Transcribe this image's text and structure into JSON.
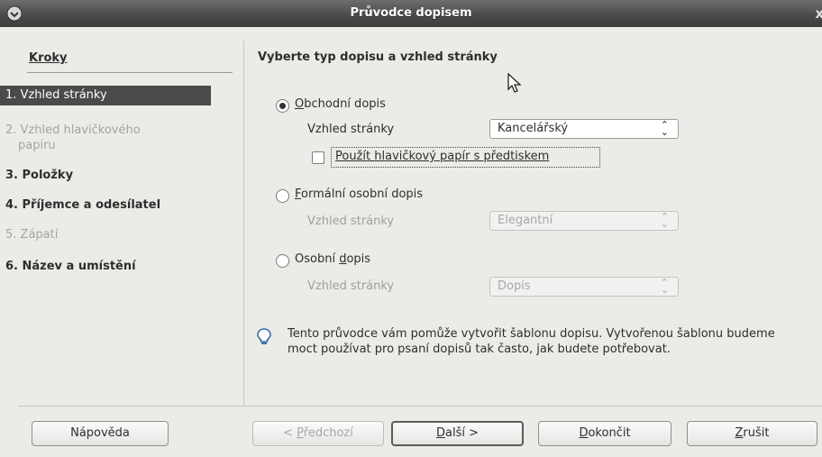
{
  "window": {
    "title": "Průvodce dopisem",
    "close_glyph": "x"
  },
  "steps": {
    "header": "Kroky",
    "items": [
      {
        "label": "1. Vzhled stránky",
        "state": "active"
      },
      {
        "label": "2. Vzhled hlavičkového",
        "label2": "papíru",
        "state": "disabled"
      },
      {
        "label": "3. Položky",
        "state": "normal"
      },
      {
        "label": "4. Příjemce a odesílatel",
        "state": "normal"
      },
      {
        "label": "5. Zápatí",
        "state": "disabled"
      },
      {
        "label": "6. Název a umístění",
        "state": "normal"
      }
    ]
  },
  "main": {
    "title": "Vyberte typ dopisu a vzhled stránky",
    "options": [
      {
        "first": "O",
        "rest": "bchodní dopis",
        "checked": true,
        "style_label": "Vzhled stránky",
        "style_value": "Kancelářský",
        "enabled": true
      },
      {
        "first": "F",
        "rest": "ormální osobní dopis",
        "checked": false,
        "style_label": "Vzhled stránky",
        "style_value": "Elegantní",
        "enabled": false
      },
      {
        "pre": "Osobní ",
        "first": "d",
        "rest": "opis",
        "checked": false,
        "style_label": "Vzhled stránky",
        "style_value": "Dopis",
        "enabled": false
      }
    ],
    "letterhead_checkbox": {
      "first": "P",
      "rest": "oužít hlavičkový papír s předtiskem",
      "checked": false
    },
    "info_text": "Tento průvodce vám pomůže vytvořit šablonu dopisu. Vytvořenou šablonu budeme moct používat pro psaní dopisů tak často, jak budete potřebovat."
  },
  "buttons": {
    "help": "Nápověda",
    "prev_pre": "< ",
    "prev_first": "P",
    "prev_rest": "ředchozí",
    "next_first": "D",
    "next_rest": "alší >",
    "finish_first": "D",
    "finish_rest": "okončit",
    "cancel_first": "Z",
    "cancel_rest": "rušit"
  }
}
